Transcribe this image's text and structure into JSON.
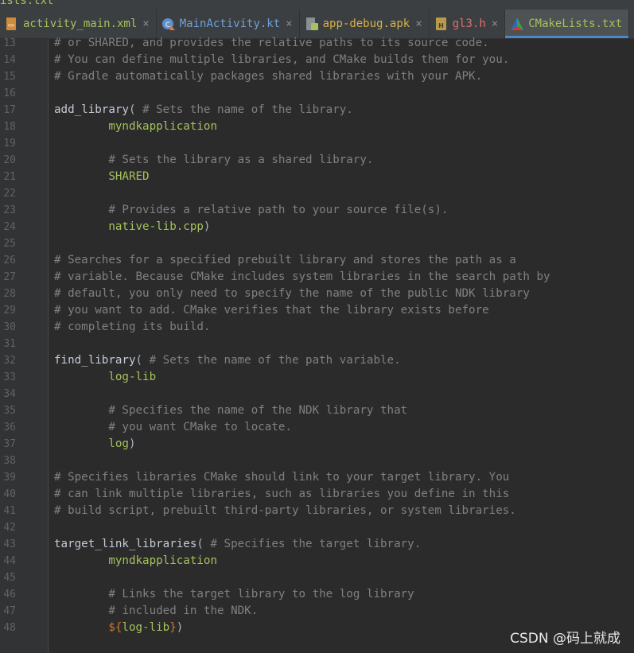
{
  "top_strip_text": "ists.txt",
  "tabs": [
    {
      "label": "activity_main.xml",
      "color": "#a5c25c",
      "icon": "xml-file-icon",
      "close": "×",
      "active": false
    },
    {
      "label": "MainActivity.kt",
      "color": "#6fa0d8",
      "icon": "kotlin-file-icon",
      "close": "×",
      "active": false
    },
    {
      "label": "app-debug.apk",
      "color": "#d6b24a",
      "icon": "apk-file-icon",
      "close": "×",
      "active": false
    },
    {
      "label": "gl3.h",
      "color": "#e07070",
      "icon": "header-file-icon",
      "close": "×",
      "active": false
    },
    {
      "label": "CMakeLists.txt",
      "color": "#a5c25c",
      "icon": "cmake-file-icon",
      "close": "",
      "active": true
    }
  ],
  "lines": [
    {
      "n": "13",
      "tokens": [
        {
          "t": "# or SHARED, and provides the relative paths to its source code.",
          "k": "comment"
        }
      ]
    },
    {
      "n": "14",
      "tokens": [
        {
          "t": "# You can define multiple libraries, and CMake builds them for you.",
          "k": "comment"
        }
      ]
    },
    {
      "n": "15",
      "tokens": [
        {
          "t": "# Gradle automatically packages shared libraries with your APK.",
          "k": "comment"
        }
      ]
    },
    {
      "n": "16",
      "tokens": []
    },
    {
      "n": "17",
      "tokens": [
        {
          "t": "add_library",
          "k": "fn"
        },
        {
          "t": "( ",
          "k": "paren"
        },
        {
          "t": "# Sets the name of the library.",
          "k": "comment"
        }
      ]
    },
    {
      "n": "18",
      "tokens": [
        {
          "t": "        myndkapplication",
          "k": "arg"
        }
      ]
    },
    {
      "n": "19",
      "tokens": []
    },
    {
      "n": "20",
      "tokens": [
        {
          "t": "        # Sets the library as a shared library.",
          "k": "comment"
        }
      ]
    },
    {
      "n": "21",
      "tokens": [
        {
          "t": "        SHARED",
          "k": "arg"
        }
      ]
    },
    {
      "n": "22",
      "tokens": []
    },
    {
      "n": "23",
      "tokens": [
        {
          "t": "        # Provides a relative path to your source file(s).",
          "k": "comment"
        }
      ]
    },
    {
      "n": "24",
      "tokens": [
        {
          "t": "        native-lib.cpp",
          "k": "arg"
        },
        {
          "t": ")",
          "k": "paren"
        }
      ]
    },
    {
      "n": "25",
      "tokens": []
    },
    {
      "n": "26",
      "tokens": [
        {
          "t": "# Searches for a specified prebuilt library and stores the path as a",
          "k": "comment"
        }
      ]
    },
    {
      "n": "27",
      "tokens": [
        {
          "t": "# variable. Because CMake includes system libraries in the search path by",
          "k": "comment"
        }
      ]
    },
    {
      "n": "28",
      "tokens": [
        {
          "t": "# default, you only need to specify the name of the public NDK library",
          "k": "comment"
        }
      ]
    },
    {
      "n": "29",
      "tokens": [
        {
          "t": "# you want to add. CMake verifies that the library exists before",
          "k": "comment"
        }
      ]
    },
    {
      "n": "30",
      "tokens": [
        {
          "t": "# completing its build.",
          "k": "comment"
        }
      ]
    },
    {
      "n": "31",
      "tokens": []
    },
    {
      "n": "32",
      "tokens": [
        {
          "t": "find_library",
          "k": "fn"
        },
        {
          "t": "( ",
          "k": "paren"
        },
        {
          "t": "# Sets the name of the path variable.",
          "k": "comment"
        }
      ]
    },
    {
      "n": "33",
      "tokens": [
        {
          "t": "        log-lib",
          "k": "arg"
        }
      ]
    },
    {
      "n": "34",
      "tokens": []
    },
    {
      "n": "35",
      "tokens": [
        {
          "t": "        # Specifies the name of the NDK library that",
          "k": "comment"
        }
      ]
    },
    {
      "n": "36",
      "tokens": [
        {
          "t": "        # you want CMake to locate.",
          "k": "comment"
        }
      ]
    },
    {
      "n": "37",
      "tokens": [
        {
          "t": "        log",
          "k": "arg"
        },
        {
          "t": ")",
          "k": "paren"
        }
      ]
    },
    {
      "n": "38",
      "tokens": []
    },
    {
      "n": "39",
      "tokens": [
        {
          "t": "# Specifies libraries CMake should link to your target library. You",
          "k": "comment"
        }
      ]
    },
    {
      "n": "40",
      "tokens": [
        {
          "t": "# can link multiple libraries, such as libraries you define in this",
          "k": "comment"
        }
      ]
    },
    {
      "n": "41",
      "tokens": [
        {
          "t": "# build script, prebuilt third-party libraries, or system libraries.",
          "k": "comment"
        }
      ]
    },
    {
      "n": "42",
      "tokens": []
    },
    {
      "n": "43",
      "tokens": [
        {
          "t": "target_link_libraries",
          "k": "fn"
        },
        {
          "t": "( ",
          "k": "paren"
        },
        {
          "t": "# Specifies the target library.",
          "k": "comment"
        }
      ]
    },
    {
      "n": "44",
      "tokens": [
        {
          "t": "        myndkapplication",
          "k": "arg"
        }
      ]
    },
    {
      "n": "45",
      "tokens": []
    },
    {
      "n": "46",
      "tokens": [
        {
          "t": "        # Links the target library to the log library",
          "k": "comment"
        }
      ]
    },
    {
      "n": "47",
      "tokens": [
        {
          "t": "        # included in the NDK.",
          "k": "comment"
        }
      ]
    },
    {
      "n": "48",
      "tokens": [
        {
          "t": "        ${",
          "k": "var"
        },
        {
          "t": "log-lib",
          "k": "arg"
        },
        {
          "t": "}",
          "k": "var"
        },
        {
          "t": ")",
          "k": "paren"
        }
      ]
    }
  ],
  "watermark": "CSDN @码上就成"
}
